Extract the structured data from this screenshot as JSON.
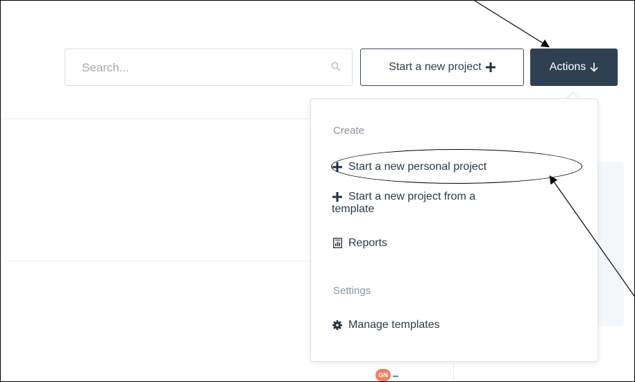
{
  "search": {
    "placeholder": "Search..."
  },
  "toolbar": {
    "new_project_label": "Start a new project",
    "new_project_icon": "plus-icon",
    "actions_label": "Actions",
    "actions_icon": "arrow-down-icon"
  },
  "dropdown": {
    "sections": [
      {
        "title": "Create",
        "items": [
          {
            "label": "Start a new personal project",
            "icon": "plus-icon"
          },
          {
            "label_line1": "Start a new project from a",
            "label_line2": "template",
            "icon": "plus-icon"
          },
          {
            "label": "Reports",
            "icon": "report-icon"
          }
        ]
      },
      {
        "title": "Settings",
        "items": [
          {
            "label": "Manage templates",
            "icon": "gear-icon"
          }
        ]
      }
    ]
  },
  "background": {
    "avatar_initials": "GN"
  },
  "colors": {
    "primary_dark": "#2f4052",
    "text": "#2c3947",
    "muted": "#8c949e",
    "border": "#d9dde3",
    "avatar": "#f08060"
  }
}
